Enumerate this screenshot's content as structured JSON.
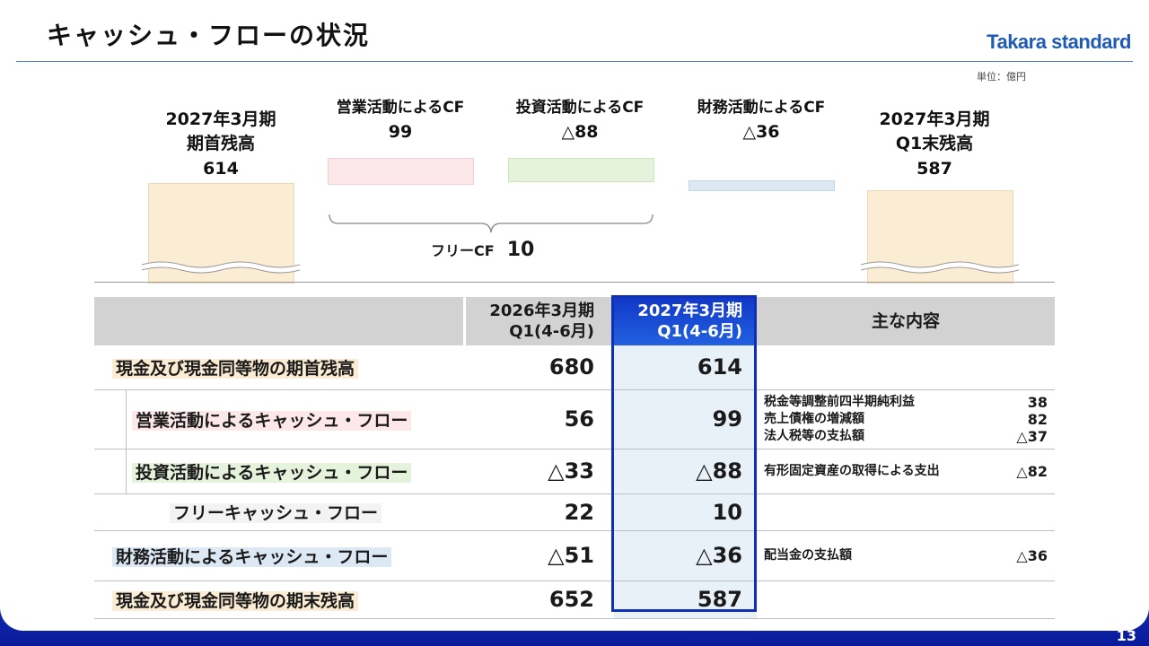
{
  "title": "キャッシュ・フローの状況",
  "logo": "Takara standard",
  "unit": "単位：億円",
  "page_number": "13",
  "waterfall": {
    "start": {
      "label_line1": "2027年3月期",
      "label_line2": "期首残高",
      "value": "614"
    },
    "operating": {
      "label": "営業活動によるCF",
      "value": "99"
    },
    "investing": {
      "label": "投資活動によるCF",
      "value": "△88"
    },
    "financing": {
      "label": "財務活動によるCF",
      "value": "△36"
    },
    "end": {
      "label_line1": "2027年3月期",
      "label_line2": "Q1末残高",
      "value": "587"
    },
    "free_cf": {
      "label": "フリーCF",
      "value": "10"
    },
    "colors": {
      "start": "#fbecd4",
      "operating": "#fce8ea",
      "investing": "#e6f3dc",
      "financing": "#dde8f5",
      "end": "#fbecd4"
    }
  },
  "table": {
    "headers": {
      "prev_line1": "2026年3月期",
      "prev_line2": "Q1(4-6月)",
      "curr_line1": "2027年3月期",
      "curr_line2": "Q1(4-6月)",
      "notes": "主な内容"
    },
    "rows": [
      {
        "label": "現金及び現金同等物の期首残高",
        "prev": "680",
        "curr": "614",
        "notes": []
      },
      {
        "label": "営業活動によるキャッシュ・フロー",
        "prev": "56",
        "curr": "99",
        "notes": [
          {
            "text": "税金等調整前四半期純利益",
            "value": "38"
          },
          {
            "text": "売上債権の増減額",
            "value": "82"
          },
          {
            "text": "法人税等の支払額",
            "value": "△37"
          }
        ]
      },
      {
        "label": "投資活動によるキャッシュ・フロー",
        "prev": "△33",
        "curr": "△88",
        "notes": [
          {
            "text": "有形固定資産の取得による支出",
            "value": "△82"
          }
        ]
      },
      {
        "label": "フリーキャッシュ・フロー",
        "prev": "22",
        "curr": "10",
        "notes": []
      },
      {
        "label": "財務活動によるキャッシュ・フロー",
        "prev": "△51",
        "curr": "△36",
        "notes": [
          {
            "text": "配当金の支払額",
            "value": "△36"
          }
        ]
      },
      {
        "label": "現金及び現金同等物の期末残高",
        "prev": "652",
        "curr": "587",
        "notes": []
      }
    ],
    "label_colors": [
      "#fbecd4",
      "#fce8ea",
      "#e6f3dc",
      "#f3f3f3",
      "#dde8f5",
      "#fbecd4"
    ]
  }
}
